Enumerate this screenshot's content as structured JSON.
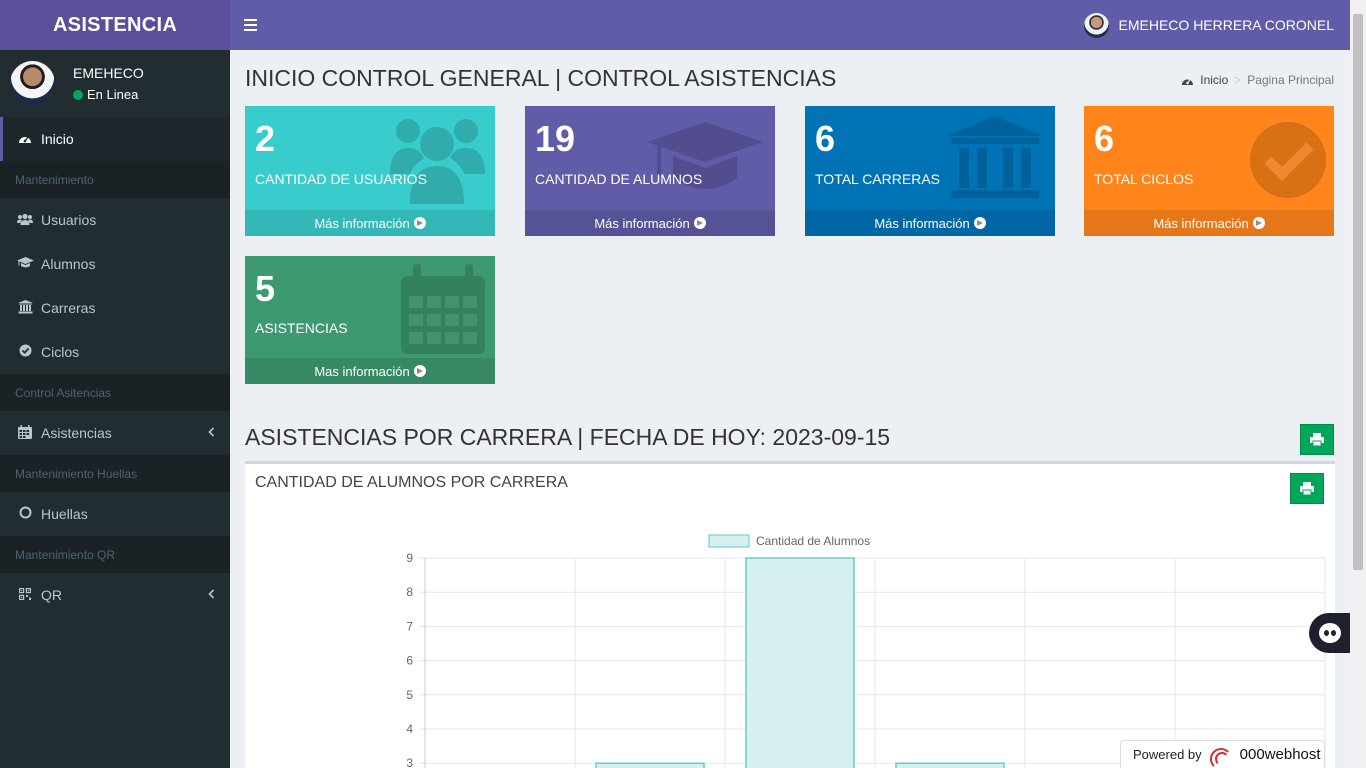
{
  "app": {
    "logo": "ASISTENCIA",
    "user_full_name": "EMEHECO HERRERA CORONEL"
  },
  "sidebar": {
    "user": {
      "name": "EMEHECO",
      "status": "En Linea"
    },
    "items": [
      {
        "type": "item",
        "label": "Inicio",
        "icon": "dashboard-icon",
        "active": true
      },
      {
        "type": "header",
        "label": "Mantenimiento"
      },
      {
        "type": "item",
        "label": "Usuarios",
        "icon": "users-icon"
      },
      {
        "type": "item",
        "label": "Alumnos",
        "icon": "graduation-cap-icon"
      },
      {
        "type": "item",
        "label": "Carreras",
        "icon": "institution-icon"
      },
      {
        "type": "item",
        "label": "Ciclos",
        "icon": "check-circle-icon"
      },
      {
        "type": "header",
        "label": "Control Asitencias"
      },
      {
        "type": "item",
        "label": "Asistencias",
        "icon": "calendar-icon",
        "chevron": true
      },
      {
        "type": "header",
        "label": "Mantenimiento Huellas"
      },
      {
        "type": "item",
        "label": "Huellas",
        "icon": "circle-icon"
      },
      {
        "type": "header",
        "label": "Mantenimiento QR"
      },
      {
        "type": "item",
        "label": "QR",
        "icon": "qrcode-icon",
        "chevron": true
      }
    ]
  },
  "page": {
    "title": "INICIO CONTROL GENERAL | CONTROL ASISTENCIAS",
    "breadcrumb": {
      "home": "Inicio",
      "current": "Pagina Principal"
    }
  },
  "stats": [
    {
      "value": "2",
      "label": "CANTIDAD DE USUARIOS",
      "more": "Más información",
      "color": "#39cccc",
      "icon": "users-icon"
    },
    {
      "value": "19",
      "label": "CANTIDAD DE ALUMNOS",
      "more": "Más información",
      "color": "#605ca8",
      "icon": "graduation-cap-icon"
    },
    {
      "value": "6",
      "label": "TOTAL CARRERAS",
      "more": "Más información",
      "color": "#0073b7",
      "icon": "institution-icon"
    },
    {
      "value": "6",
      "label": "TOTAL CICLOS",
      "more": "Más información",
      "color": "#ff851b",
      "icon": "check-circle-icon"
    },
    {
      "value": "5",
      "label": "ASISTENCIAS",
      "more": "Mas información",
      "color": "#3d9970",
      "icon": "calendar-icon"
    }
  ],
  "section": {
    "title": "ASISTENCIAS POR CARRERA | FECHA DE HOY: 2023-09-15",
    "card_title": "CANTIDAD DE ALUMNOS POR CARRERA"
  },
  "chart_data": {
    "type": "bar",
    "title": "",
    "xlabel": "",
    "ylabel": "",
    "series": [
      {
        "name": "Cantidad de Alumnos",
        "values": [
          3,
          9,
          3
        ]
      }
    ],
    "categories": [],
    "ylim": [
      0,
      9
    ],
    "visible_yticks": [
      3,
      4,
      5,
      6,
      7,
      8,
      9
    ],
    "legend": "top",
    "grid": true,
    "colors": {
      "fill": "#d6f0f0",
      "stroke": "#6cc9c9"
    }
  },
  "footer": {
    "powered_by": "Powered by",
    "host": "000webhost"
  }
}
